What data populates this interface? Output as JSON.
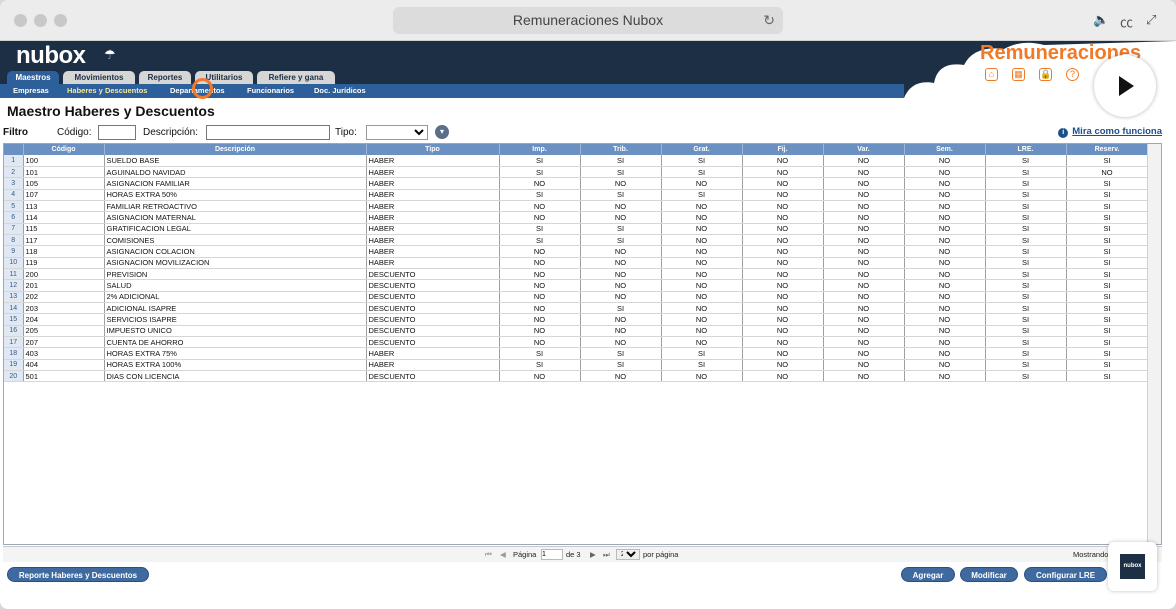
{
  "browser": {
    "title": "Remuneraciones Nubox"
  },
  "header": {
    "logo": "nubox",
    "product_title": "Remuneraciones",
    "icons": [
      "home-icon",
      "grid-icon",
      "lock-icon",
      "help-icon"
    ]
  },
  "tabs": [
    {
      "label": "Maestros",
      "active": true
    },
    {
      "label": "Movimientos",
      "active": false
    },
    {
      "label": "Reportes",
      "active": false
    },
    {
      "label": "Utilitarios",
      "active": false
    },
    {
      "label": "Refiere y gana",
      "active": false
    }
  ],
  "subnav": [
    {
      "label": "Empresas",
      "active": false
    },
    {
      "label": "Haberes y Descuentos",
      "active": true
    },
    {
      "label": "Departamentos",
      "active": false
    },
    {
      "label": "Funcionarios",
      "active": false
    },
    {
      "label": "Doc. Jurídicos",
      "active": false
    }
  ],
  "page": {
    "title": "Maestro Haberes y Descuentos",
    "filter_label": "Filtro",
    "codigo_label": "Código:",
    "descripcion_label": "Descripción:",
    "tipo_label": "Tipo:",
    "help_link": "Mira como funciona"
  },
  "table": {
    "headers": [
      "Código",
      "Descripción",
      "Tipo",
      "Imp.",
      "Trib.",
      "Grat.",
      "Fij.",
      "Var.",
      "Sem.",
      "LRE.",
      "Reserv."
    ],
    "rows": [
      [
        "1",
        "100",
        "SUELDO BASE",
        "HABER",
        "SI",
        "SI",
        "SI",
        "NO",
        "NO",
        "NO",
        "SI",
        "SI"
      ],
      [
        "2",
        "101",
        "AGUINALDO NAVIDAD",
        "HABER",
        "SI",
        "SI",
        "SI",
        "NO",
        "NO",
        "NO",
        "SI",
        "NO"
      ],
      [
        "3",
        "105",
        "ASIGNACION FAMILIAR",
        "HABER",
        "NO",
        "NO",
        "NO",
        "NO",
        "NO",
        "NO",
        "SI",
        "SI"
      ],
      [
        "4",
        "107",
        "HORAS EXTRA 50%",
        "HABER",
        "SI",
        "SI",
        "SI",
        "NO",
        "NO",
        "NO",
        "SI",
        "SI"
      ],
      [
        "5",
        "113",
        "FAMILIAR RETROACTIVO",
        "HABER",
        "NO",
        "NO",
        "NO",
        "NO",
        "NO",
        "NO",
        "SI",
        "SI"
      ],
      [
        "6",
        "114",
        "ASIGNACION MATERNAL",
        "HABER",
        "NO",
        "NO",
        "NO",
        "NO",
        "NO",
        "NO",
        "SI",
        "SI"
      ],
      [
        "7",
        "115",
        "GRATIFICACION LEGAL",
        "HABER",
        "SI",
        "SI",
        "NO",
        "NO",
        "NO",
        "NO",
        "SI",
        "SI"
      ],
      [
        "8",
        "117",
        "COMISIONES",
        "HABER",
        "SI",
        "SI",
        "NO",
        "NO",
        "NO",
        "NO",
        "SI",
        "SI"
      ],
      [
        "9",
        "118",
        "ASIGNACION COLACION",
        "HABER",
        "NO",
        "NO",
        "NO",
        "NO",
        "NO",
        "NO",
        "SI",
        "SI"
      ],
      [
        "10",
        "119",
        "ASIGNACION MOVILIZACION",
        "HABER",
        "NO",
        "NO",
        "NO",
        "NO",
        "NO",
        "NO",
        "SI",
        "SI"
      ],
      [
        "11",
        "200",
        "PREVISION",
        "DESCUENTO",
        "NO",
        "NO",
        "NO",
        "NO",
        "NO",
        "NO",
        "SI",
        "SI"
      ],
      [
        "12",
        "201",
        "SALUD",
        "DESCUENTO",
        "NO",
        "NO",
        "NO",
        "NO",
        "NO",
        "NO",
        "SI",
        "SI"
      ],
      [
        "13",
        "202",
        "2% ADICIONAL",
        "DESCUENTO",
        "NO",
        "NO",
        "NO",
        "NO",
        "NO",
        "NO",
        "SI",
        "SI"
      ],
      [
        "14",
        "203",
        "ADICIONAL ISAPRE",
        "DESCUENTO",
        "NO",
        "SI",
        "NO",
        "NO",
        "NO",
        "NO",
        "SI",
        "SI"
      ],
      [
        "15",
        "204",
        "SERVICIOS ISAPRE",
        "DESCUENTO",
        "NO",
        "NO",
        "NO",
        "NO",
        "NO",
        "NO",
        "SI",
        "SI"
      ],
      [
        "16",
        "205",
        "IMPUESTO UNICO",
        "DESCUENTO",
        "NO",
        "NO",
        "NO",
        "NO",
        "NO",
        "NO",
        "SI",
        "SI"
      ],
      [
        "17",
        "207",
        "CUENTA DE AHORRO",
        "DESCUENTO",
        "NO",
        "NO",
        "NO",
        "NO",
        "NO",
        "NO",
        "SI",
        "SI"
      ],
      [
        "18",
        "403",
        "HORAS EXTRA 75%",
        "HABER",
        "SI",
        "SI",
        "SI",
        "NO",
        "NO",
        "NO",
        "SI",
        "SI"
      ],
      [
        "19",
        "404",
        "HORAS EXTRA 100%",
        "HABER",
        "SI",
        "SI",
        "SI",
        "NO",
        "NO",
        "NO",
        "SI",
        "SI"
      ],
      [
        "20",
        "501",
        "DIAS CON LICENCIA",
        "DESCUENTO",
        "NO",
        "NO",
        "NO",
        "NO",
        "NO",
        "NO",
        "SI",
        "SI"
      ]
    ]
  },
  "pager": {
    "page_label": "Página",
    "page_value": "1",
    "of_label": "de 3",
    "per_page": "20",
    "per_page_label": "por página",
    "showing": "Mostrando"
  },
  "buttons": {
    "report": "Reporte Haberes y Descuentos",
    "add": "Agregar",
    "edit": "Modificar",
    "config": "Configurar LRE"
  },
  "mini_logo": "nubox"
}
